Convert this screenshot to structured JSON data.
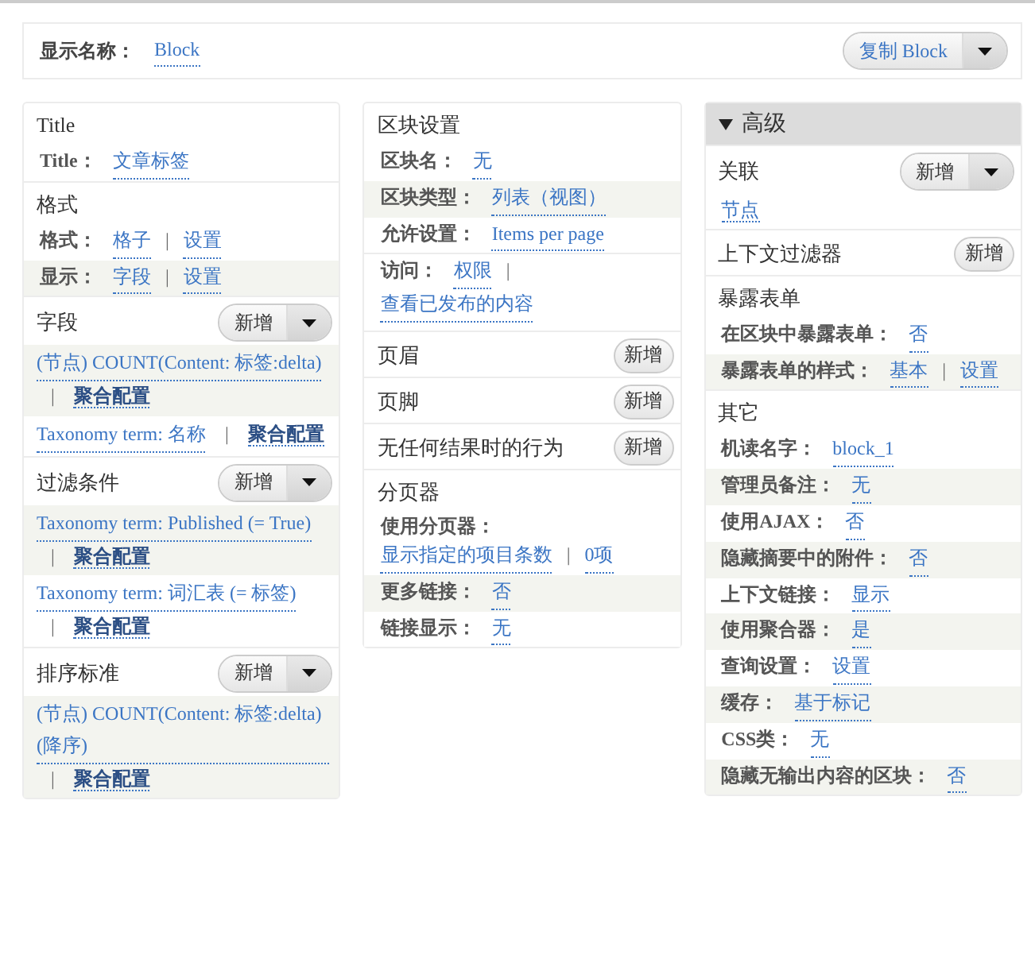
{
  "sep": "|",
  "top": {
    "label": "显示名称：",
    "value": "Block",
    "button": "复制 Block"
  },
  "columns": [
    {
      "sections": [
        {
          "title": "Title",
          "rows": [
            {
              "kind": "setting",
              "label": "Title：",
              "links": [
                "文章标签"
              ]
            }
          ]
        },
        {
          "title": "格式",
          "rows": [
            {
              "kind": "setting",
              "label": "格式：",
              "links": [
                "格子",
                "设置"
              ]
            },
            {
              "kind": "setting",
              "label": "显示：",
              "links": [
                "字段",
                "设置"
              ]
            }
          ]
        },
        {
          "title": "字段",
          "add": {
            "label": "新增",
            "dropdown": true
          },
          "rows": [
            {
              "kind": "item",
              "links": [
                "(节点) COUNT(Content: 标签:delta)",
                "聚合配置"
              ]
            },
            {
              "kind": "item",
              "links": [
                "Taxonomy term: 名称",
                "聚合配置"
              ]
            }
          ]
        },
        {
          "title": "过滤条件",
          "add": {
            "label": "新增",
            "dropdown": true
          },
          "rows": [
            {
              "kind": "item",
              "links": [
                "Taxonomy term: Published (= True)",
                "聚合配置"
              ]
            },
            {
              "kind": "item",
              "links": [
                "Taxonomy term: 词汇表 (= 标签)",
                "聚合配置"
              ]
            }
          ]
        },
        {
          "title": "排序标准",
          "add": {
            "label": "新增",
            "dropdown": true
          },
          "rows": [
            {
              "kind": "item",
              "links": [
                "(节点) COUNT(Content: 标签:delta) (降序)",
                "聚合配置"
              ]
            }
          ]
        }
      ]
    },
    {
      "sections": [
        {
          "title": "区块设置",
          "rows": [
            {
              "kind": "setting",
              "label": "区块名：",
              "links": [
                "无"
              ]
            },
            {
              "kind": "setting",
              "label": "区块类型：",
              "links": [
                "列表（视图）"
              ]
            },
            {
              "kind": "setting",
              "label": "允许设置：",
              "links": [
                "Items per page"
              ]
            }
          ]
        },
        {
          "rows": [
            {
              "kind": "setting",
              "label": "访问：",
              "links": [
                "权限",
                "查看已发布的内容"
              ]
            }
          ]
        },
        {
          "title": "页眉",
          "add": {
            "label": "新增",
            "dropdown": false
          }
        },
        {
          "title": "页脚",
          "add": {
            "label": "新增",
            "dropdown": false
          }
        },
        {
          "title": "无任何结果时的行为",
          "add": {
            "label": "新增",
            "dropdown": false
          }
        },
        {
          "title": "分页器",
          "rows": [
            {
              "kind": "pager",
              "label": "使用分页器：",
              "links": [
                "显示指定的项目条数",
                "0项"
              ]
            },
            {
              "kind": "setting",
              "label": "更多链接：",
              "links": [
                "否"
              ]
            },
            {
              "kind": "setting",
              "label": "链接显示：",
              "links": [
                "无"
              ]
            }
          ]
        }
      ]
    },
    {
      "header": {
        "title": "高级",
        "expanded": true
      },
      "sections": [
        {
          "title": "关联",
          "add": {
            "label": "新增",
            "dropdown": true
          },
          "rows": [
            {
              "kind": "link",
              "links": [
                "节点"
              ]
            }
          ]
        },
        {
          "title": "上下文过滤器",
          "add": {
            "label": "新增",
            "dropdown": false
          }
        },
        {
          "title": "暴露表单",
          "rows": [
            {
              "kind": "setting",
              "label": "在区块中暴露表单：",
              "links": [
                "否"
              ]
            },
            {
              "kind": "setting",
              "label": "暴露表单的样式：",
              "links": [
                "基本",
                "设置"
              ]
            }
          ]
        },
        {
          "title": "其它",
          "rows": [
            {
              "kind": "setting",
              "label": "机读名字：",
              "links": [
                "block_1"
              ]
            },
            {
              "kind": "setting",
              "label": "管理员备注：",
              "links": [
                "无"
              ]
            },
            {
              "kind": "setting",
              "label": "使用AJAX：",
              "links": [
                "否"
              ]
            },
            {
              "kind": "setting",
              "label": "隐藏摘要中的附件：",
              "links": [
                "否"
              ]
            },
            {
              "kind": "setting",
              "label": "上下文链接：",
              "links": [
                "显示"
              ]
            },
            {
              "kind": "setting",
              "label": "使用聚合器：",
              "links": [
                "是"
              ]
            },
            {
              "kind": "setting",
              "label": "查询设置：",
              "links": [
                "设置"
              ]
            },
            {
              "kind": "setting",
              "label": "缓存：",
              "links": [
                "基于标记"
              ]
            },
            {
              "kind": "setting",
              "label": "CSS类：",
              "links": [
                "无"
              ]
            },
            {
              "kind": "setting",
              "label": "隐藏无输出内容的区块：",
              "links": [
                "否"
              ]
            }
          ]
        }
      ]
    }
  ]
}
